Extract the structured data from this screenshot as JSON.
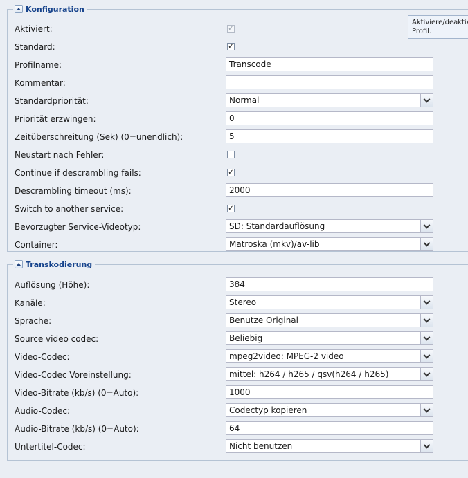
{
  "tooltip": {
    "text": "Aktiviere/deaktiviere Profil."
  },
  "konfiguration": {
    "title": "Konfiguration",
    "rows": [
      {
        "label": "Aktiviert:",
        "type": "checkbox",
        "checked": true,
        "disabled": true
      },
      {
        "label": "Standard:",
        "type": "checkbox",
        "checked": true
      },
      {
        "label": "Profilname:",
        "type": "text",
        "value": "Transcode"
      },
      {
        "label": "Kommentar:",
        "type": "text",
        "value": ""
      },
      {
        "label": "Standardpriorität:",
        "type": "select",
        "value": "Normal"
      },
      {
        "label": "Priorität erzwingen:",
        "type": "text",
        "value": "0"
      },
      {
        "label": "Zeitüberschreitung (Sek) (0=unendlich):",
        "type": "text",
        "value": "5"
      },
      {
        "label": "Neustart nach Fehler:",
        "type": "checkbox",
        "checked": false
      },
      {
        "label": "Continue if descrambling fails:",
        "type": "checkbox",
        "checked": true
      },
      {
        "label": "Descrambling timeout (ms):",
        "type": "text",
        "value": "2000"
      },
      {
        "label": "Switch to another service:",
        "type": "checkbox",
        "checked": true
      },
      {
        "label": "Bevorzugter Service-Videotyp:",
        "type": "select",
        "value": "SD: Standardauflösung"
      },
      {
        "label": "Container:",
        "type": "select",
        "value": "Matroska (mkv)/av-lib"
      }
    ]
  },
  "transkodierung": {
    "title": "Transkodierung",
    "rows": [
      {
        "label": "Auflösung (Höhe):",
        "type": "text",
        "value": "384"
      },
      {
        "label": "Kanäle:",
        "type": "select",
        "value": "Stereo"
      },
      {
        "label": "Sprache:",
        "type": "select",
        "value": "Benutze Original"
      },
      {
        "label": "Source video codec:",
        "type": "select",
        "value": "Beliebig"
      },
      {
        "label": "Video-Codec:",
        "type": "select",
        "value": "mpeg2video: MPEG-2 video"
      },
      {
        "label": "Video-Codec Voreinstellung:",
        "type": "select",
        "value": "mittel: h264 / h265 / qsv(h264 / h265)"
      },
      {
        "label": "Video-Bitrate (kb/s) (0=Auto):",
        "type": "text",
        "value": "1000"
      },
      {
        "label": "Audio-Codec:",
        "type": "select",
        "value": "Codectyp kopieren"
      },
      {
        "label": "Audio-Bitrate (kb/s) (0=Auto):",
        "type": "text",
        "value": "64"
      },
      {
        "label": "Untertitel-Codec:",
        "type": "select",
        "value": "Nicht benutzen"
      }
    ]
  }
}
